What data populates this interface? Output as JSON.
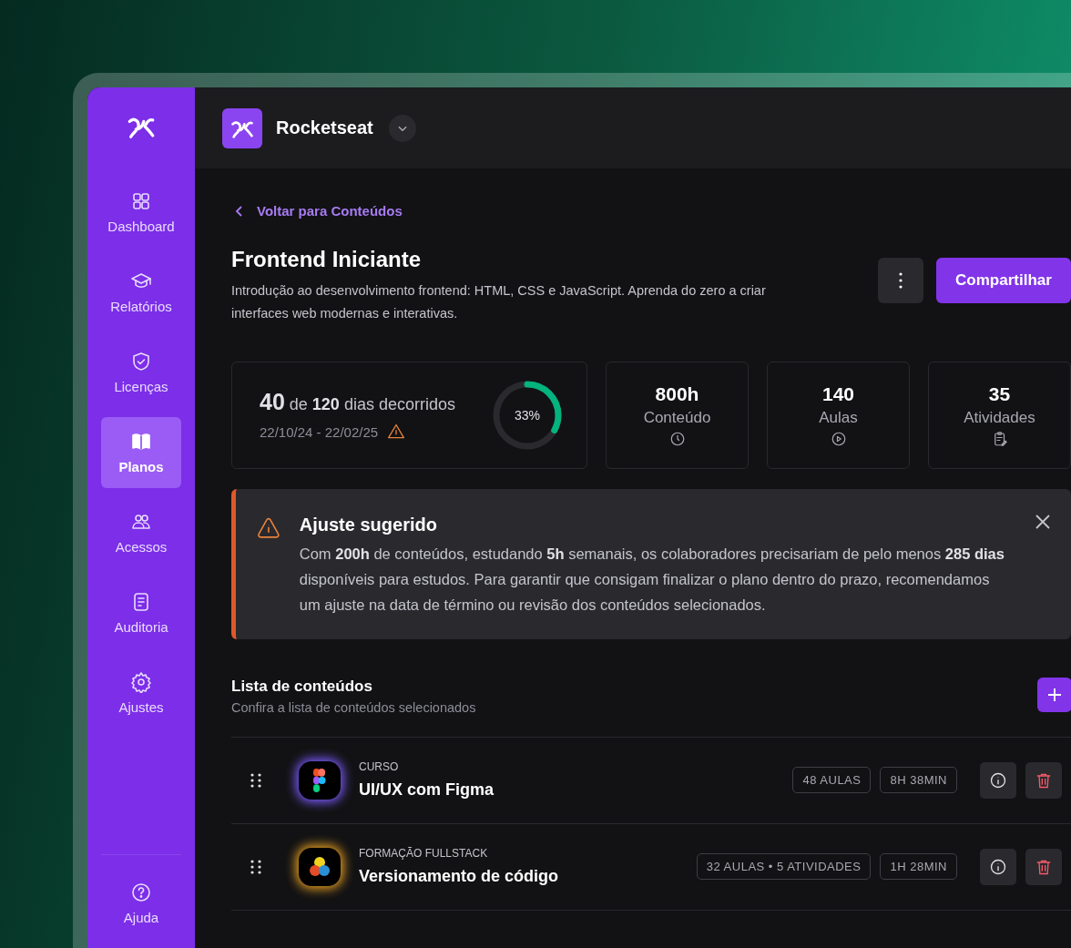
{
  "sidebar": {
    "items": [
      {
        "label": "Dashboard",
        "selected": false
      },
      {
        "label": "Relatórios",
        "selected": false
      },
      {
        "label": "Licenças",
        "selected": false
      },
      {
        "label": "Planos",
        "selected": true
      },
      {
        "label": "Acessos",
        "selected": false
      },
      {
        "label": "Auditoria",
        "selected": false
      },
      {
        "label": "Ajustes",
        "selected": false
      }
    ],
    "footer_item": {
      "label": "Ajuda",
      "selected": false
    }
  },
  "header": {
    "workspace": "Rocketseat"
  },
  "back_link": "Voltar para Conteúdos",
  "plan": {
    "title": "Frontend Iniciante",
    "description": "Introdução ao desenvolvimento frontend: HTML, CSS e JavaScript. Aprenda do zero a criar interfaces web modernas e interativas.",
    "share_button": "Compartilhar"
  },
  "progress": {
    "summary": "**40** de **120** dias decorridos",
    "dates": "22/10/24 - 22/02/25",
    "warning": true,
    "level": 0.33,
    "reading": "33%"
  },
  "stats": [
    {
      "value": "800h",
      "label": "Conteúdo"
    },
    {
      "value": "140",
      "label": "Aulas"
    },
    {
      "value": "35",
      "label": "Atividades"
    }
  ],
  "alert": {
    "title": "Ajuste sugerido",
    "text": "Com **200h** de conteúdos, estudando **5h** semanais, os colaboradores precisariam de pelo menos **285 dias** disponíveis para estudos. Para garantir que consigam finalizar o plano dentro do prazo, recomendamos um ajuste na data de término ou revisão dos conteúdos selecionados."
  },
  "content_list": {
    "title": "Lista de conteúdos",
    "subtitle": "Confira a lista de conteúdos selecionados",
    "items": [
      {
        "type": "CURSO",
        "title": "UI/UX com Figma",
        "tags": [
          "48 AULAS",
          "8H 38MIN"
        ]
      },
      {
        "type": "FORMAÇÃO FULLSTACK",
        "title": "Versionamento de código",
        "tags": [
          "32 AULAS • 5 ATIVIDADES",
          "1H 28MIN"
        ]
      }
    ]
  }
}
